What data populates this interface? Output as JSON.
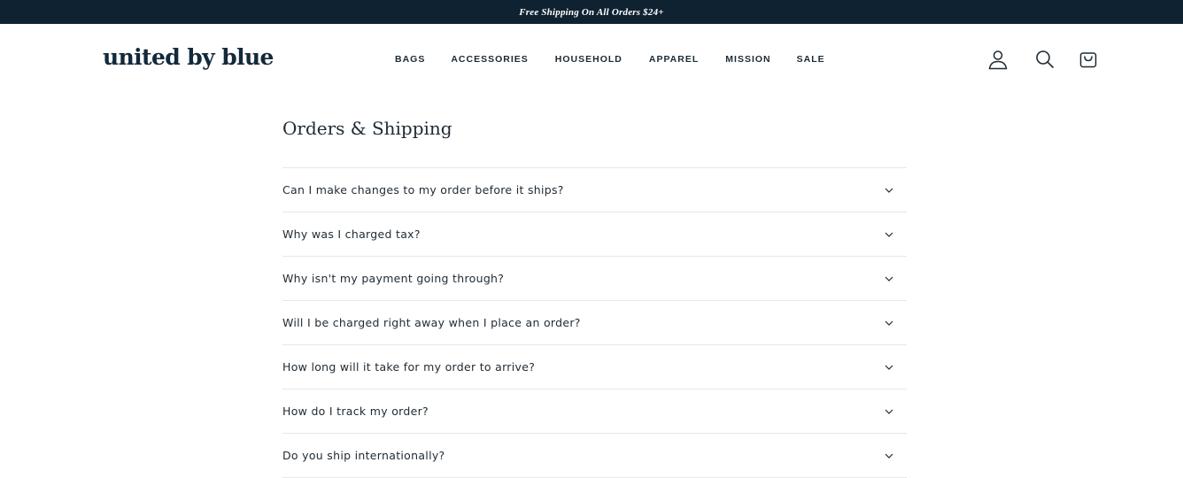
{
  "announcement": {
    "text": "Free Shipping On All Orders $24+"
  },
  "header": {
    "logo": "united by blue",
    "nav": [
      {
        "label": "BAGS"
      },
      {
        "label": "ACCESSORIES"
      },
      {
        "label": "HOUSEHOLD"
      },
      {
        "label": "APPAREL"
      },
      {
        "label": "MISSION"
      },
      {
        "label": "SALE"
      }
    ],
    "icons": {
      "account": "user-icon",
      "search": "search-icon",
      "cart": "cart-icon"
    }
  },
  "main": {
    "title": "Orders & Shipping",
    "faqs": [
      {
        "question": "Can I make changes to my order before it ships?"
      },
      {
        "question": "Why was I charged tax?"
      },
      {
        "question": "Why isn't my payment going through?"
      },
      {
        "question": "Will I be charged right away when I place an order?"
      },
      {
        "question": "How long will it take for my order to arrive?"
      },
      {
        "question": "How do I track my order?"
      },
      {
        "question": "Do you ship internationally?"
      }
    ]
  },
  "colors": {
    "announcement_bg": "#0f2232",
    "logo": "#13293a",
    "text": "#1f2a33",
    "divider": "#e5e7e9"
  }
}
